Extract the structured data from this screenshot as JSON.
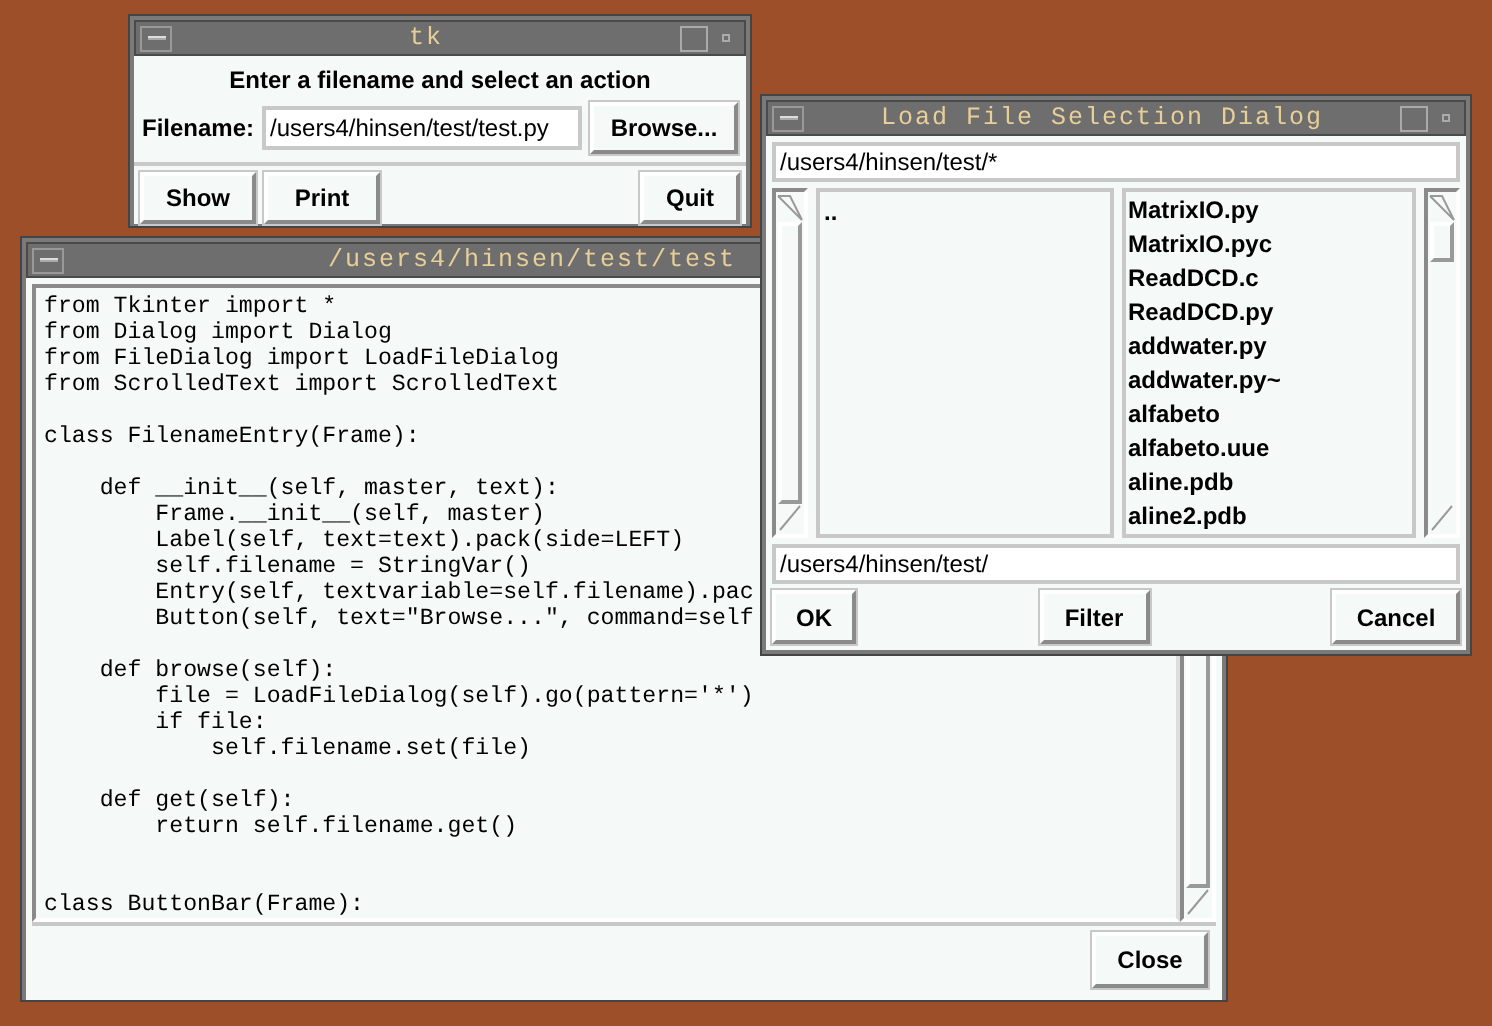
{
  "windows": [
    {
      "kind": "entry_app",
      "title": "tk",
      "prompt": "Enter a filename and select an action",
      "field_label": "Filename:",
      "field_value": "/users4/hinsen/test/test.py",
      "browse": "Browse...",
      "buttons": [
        "Show",
        "Print",
        "Quit"
      ]
    },
    {
      "kind": "editor",
      "title": "/users4/hinsen/test/test",
      "code": "from Tkinter import *\nfrom Dialog import Dialog\nfrom FileDialog import LoadFileDialog\nfrom ScrolledText import ScrolledText\n\nclass FilenameEntry(Frame):\n\n    def __init__(self, master, text):\n        Frame.__init__(self, master)\n        Label(self, text=text).pack(side=LEFT)\n        self.filename = StringVar()\n        Entry(self, textvariable=self.filename).pac\n        Button(self, text=\"Browse...\", command=self\n\n    def browse(self):\n        file = LoadFileDialog(self).go(pattern='*')\n        if file:\n            self.filename.set(file)\n\n    def get(self):\n        return self.filename.get()\n\n\nclass ButtonBar(Frame):",
      "close": "Close"
    },
    {
      "kind": "file_dialog",
      "title": "Load File Selection Dialog",
      "filter": "/users4/hinsen/test/*",
      "directories": [
        ".."
      ],
      "files": [
        "MatrixIO.py",
        "MatrixIO.pyc",
        "ReadDCD.c",
        "ReadDCD.py",
        "addwater.py",
        "addwater.py~",
        "alfabeto",
        "alfabeto.uue",
        "aline.pdb",
        "aline2.pdb"
      ],
      "selection": "/users4/hinsen/test/",
      "buttons": [
        "OK",
        "Filter",
        "Cancel"
      ]
    }
  ]
}
